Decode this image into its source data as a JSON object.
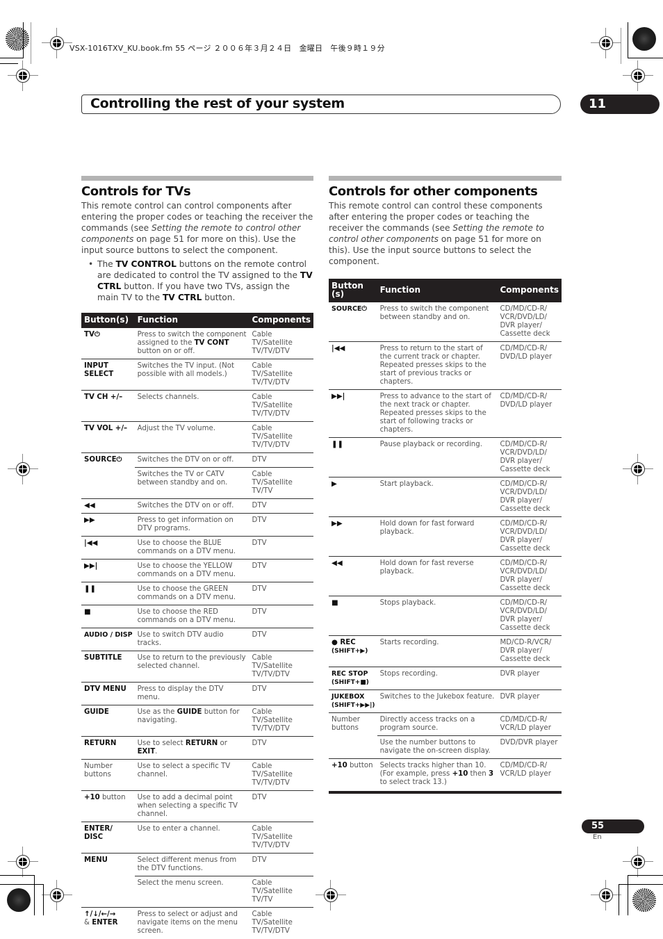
{
  "file_info": "VSX-1016TXV_KU.book.fm  55 ページ  ２００６年３月２４日　金曜日　午後９時１９分",
  "chapter": {
    "title": "Controlling the rest of your system",
    "number": "11"
  },
  "left": {
    "title": "Controls for TVs",
    "intro_parts": [
      "This remote control can control components after entering the proper codes or teaching the receiver the commands (see ",
      "Setting the remote to control other components",
      " on page 51 for more on this). Use the input source buttons to select the component."
    ],
    "bullet_parts": [
      "The ",
      "TV CONTROL",
      " buttons on the remote control are dedicated to control the TV assigned to the ",
      "TV CTRL",
      " button. If you have two TVs, assign the main TV to the ",
      "TV CTRL",
      " button."
    ],
    "table": {
      "headers": [
        "Button(s)",
        "Function",
        "Components"
      ],
      "rows": [
        {
          "button": "TV⏻",
          "function_parts": [
            "Press to switch the component assigned to the ",
            "TV CONT",
            " button on or off."
          ],
          "components": "Cable TV/Satellite TV/TV/DTV"
        },
        {
          "button": "INPUT SELECT",
          "function": "Switches the TV input. (Not possible with all models.)",
          "components": "Cable TV/Satellite TV/TV/DTV"
        },
        {
          "button": "TV CH +/–",
          "function": "Selects channels.",
          "components": "Cable TV/Satellite TV/TV/DTV"
        },
        {
          "button": "TV VOL +/–",
          "function": "Adjust the TV volume.",
          "components": "Cable TV/Satellite TV/TV/DTV"
        },
        {
          "button": "SOURCE⏻",
          "function": "Switches the DTV on or off.",
          "components": "DTV"
        },
        {
          "button": "",
          "function": "Switches the TV or CATV between standby and on.",
          "components": "Cable TV/Satellite TV/TV"
        },
        {
          "button": "◀◀",
          "function": "Switches the DTV on or off.",
          "components": "DTV"
        },
        {
          "button": "▶▶",
          "function": "Press to get information on DTV programs.",
          "components": "DTV"
        },
        {
          "button": "|◀◀",
          "function": "Use to choose the BLUE commands on a DTV menu.",
          "components": "DTV"
        },
        {
          "button": "▶▶|",
          "function": "Use to choose the YELLOW commands on a DTV menu.",
          "components": "DTV"
        },
        {
          "button": "❚❚",
          "function": "Use to choose the GREEN commands on a DTV menu.",
          "components": "DTV"
        },
        {
          "button": "■",
          "function": "Use to choose the RED commands on a DTV menu.",
          "components": "DTV"
        },
        {
          "button": "AUDIO / DISP",
          "function": "Use to switch DTV audio tracks.",
          "components": "DTV"
        },
        {
          "button": "SUBTITLE",
          "function": "Use to return to the previously selected channel.",
          "components": "Cable TV/Satellite TV/TV/DTV"
        },
        {
          "button": "DTV MENU",
          "function": "Press to display the DTV menu.",
          "components": "DTV"
        },
        {
          "button": "GUIDE",
          "function_parts": [
            "Use as the ",
            "GUIDE",
            " button for navigating."
          ],
          "components": "Cable TV/Satellite TV/TV/DTV"
        },
        {
          "button": "RETURN",
          "function_parts": [
            "Use to select ",
            "RETURN",
            " or ",
            "EXIT",
            "."
          ],
          "components": "DTV"
        },
        {
          "button": "Number buttons",
          "function": "Use to select a specific TV channel.",
          "components": "Cable TV/Satellite TV/TV/DTV"
        },
        {
          "button_bold": "+10",
          "button_rest": " button",
          "function": "Use to add a decimal point when selecting a specific TV channel.",
          "components": "DTV"
        },
        {
          "button": "ENTER/ DISC",
          "function": "Use to enter a channel.",
          "components": "Cable TV/Satellite TV/TV/DTV"
        },
        {
          "button": "MENU",
          "function": "Select different menus from the DTV functions.",
          "components": "DTV"
        },
        {
          "button": "",
          "function": "Select the menu screen.",
          "components": "Cable TV/Satellite TV/TV"
        },
        {
          "button_bold": "↑/↓/←/→",
          "button_rest": "& ",
          "button_bold2": "ENTER",
          "function": "Press to select or adjust and navigate items on the menu screen.",
          "components": "Cable TV/Satellite TV/TV/DTV"
        }
      ]
    }
  },
  "right": {
    "title": "Controls for other components",
    "intro_parts": [
      "This remote control can control these components after entering the proper codes or teaching the receiver the commands (see ",
      "Setting the remote to control other components",
      " on page 51 for more on this). Use the input source buttons to select the component."
    ],
    "table": {
      "headers": [
        "Button (s)",
        "Function",
        "Components"
      ],
      "rows": [
        {
          "button": "SOURCE⏻",
          "function": "Press to switch the component between standby and on.",
          "components": "CD/MD/CD-R/ VCR/DVD/LD/ DVR player/ Cassette deck"
        },
        {
          "button": "|◀◀",
          "function": "Press to return to the start of the current track or chapter. Repeated presses skips to the start of previous tracks or chapters.",
          "components": "CD/MD/CD-R/ DVD/LD player"
        },
        {
          "button": "▶▶|",
          "function": "Press to advance to the start of the next track or chapter. Repeated presses skips to the start of following tracks or chapters.",
          "components": "CD/MD/CD-R/ DVD/LD player"
        },
        {
          "button": "❚❚",
          "function": "Pause playback or recording.",
          "components": "CD/MD/CD-R/ VCR/DVD/LD/ DVR player/ Cassette deck"
        },
        {
          "button": "▶",
          "function": "Start playback.",
          "components": "CD/MD/CD-R/ VCR/DVD/LD/ DVR player/ Cassette deck"
        },
        {
          "button": "▶▶",
          "function": "Hold down for fast forward playback.",
          "components": "CD/MD/CD-R/ VCR/DVD/LD/ DVR player/ Cassette deck"
        },
        {
          "button": "◀◀",
          "function": "Hold down for fast reverse playback.",
          "components": "CD/MD/CD-R/ VCR/DVD/LD/ DVR player/ Cassette deck"
        },
        {
          "button": "■",
          "function": "Stops playback.",
          "components": "CD/MD/CD-R/ VCR/DVD/LD/ DVR player/ Cassette deck"
        },
        {
          "button": "● REC",
          "button_sub": "(SHIFT+▶)",
          "function": "Starts recording.",
          "components": "MD/CD-R/VCR/ DVR player/ Cassette deck"
        },
        {
          "button": "REC STOP",
          "button_sub": "(SHIFT+■)",
          "function": "Stops recording.",
          "components": "DVR player"
        },
        {
          "button": "JUKEBOX",
          "button_sub": "(SHIFT+▶▶|)",
          "function": "Switches to the Jukebox feature.",
          "components": "DVR player"
        },
        {
          "button": "Number buttons",
          "function": "Directly access tracks on a program source.",
          "components": "CD/MD/CD-R/ VCR/LD player"
        },
        {
          "button": "",
          "function": "Use the number buttons to navigate the on-screen display.",
          "components": "DVD/DVR player"
        },
        {
          "button_bold": "+10",
          "button_rest": " button",
          "function_parts": [
            "Selects tracks higher than 10. (For example, press ",
            "+10",
            " then ",
            "3",
            " to select track 13.)"
          ],
          "components": "CD/MD/CD-R/ VCR/LD player"
        }
      ]
    }
  },
  "footer": {
    "page_number": "55",
    "language": "En"
  }
}
